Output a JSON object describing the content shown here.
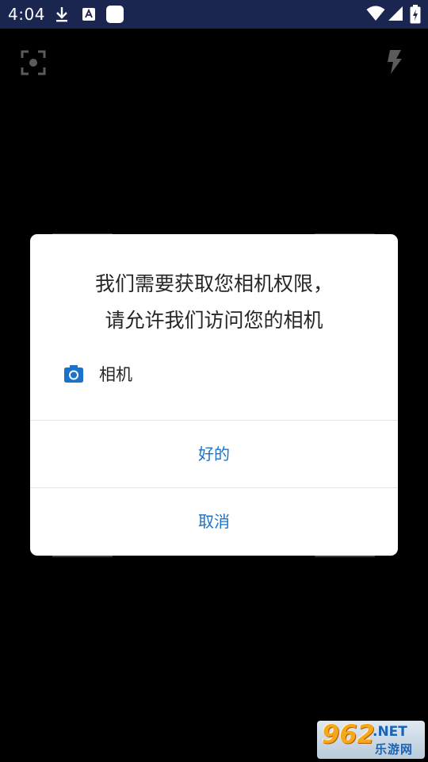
{
  "status_bar": {
    "time": "4:04",
    "icons": [
      "download-icon",
      "a-notification-icon",
      "square-icon",
      "wifi-icon",
      "signal-icon",
      "battery-icon"
    ],
    "background": "#1a2650"
  },
  "camera": {
    "icons": [
      "focus-icon",
      "flash-icon"
    ]
  },
  "dialog": {
    "title_line1": "我们需要获取您相机权限，",
    "title_line2": "请允许我们访问您的相机",
    "permission": {
      "icon": "camera-icon",
      "label": "相机"
    },
    "ok_label": "好的",
    "cancel_label": "取消",
    "accent_color": "#1a73c8"
  },
  "watermark": {
    "number": "962",
    "suffix": ".NET",
    "chinese": "乐游网"
  }
}
